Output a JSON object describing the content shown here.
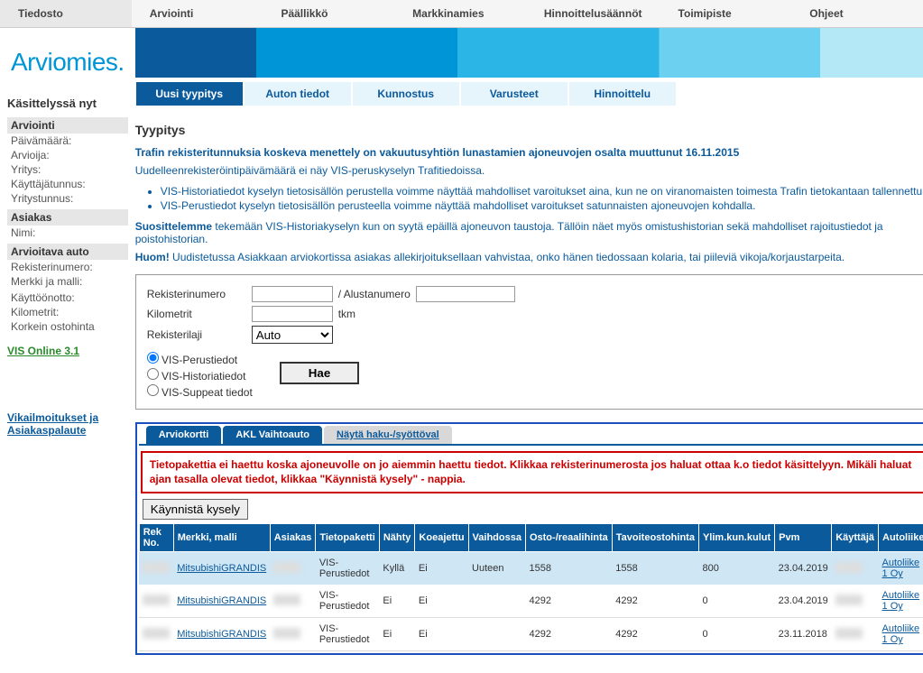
{
  "menubar": [
    "Tiedosto",
    "Arviointi",
    "Päällikkö",
    "Markkinamies",
    "Hinnoittelusäännöt",
    "Toimipiste",
    "Ohjeet"
  ],
  "logo": "Arviomies",
  "logo_suffix": ".",
  "tabs_primary": [
    {
      "label": "Uusi tyypitys",
      "active": true
    },
    {
      "label": "Auton tiedot",
      "active": false
    },
    {
      "label": "Kunnostus",
      "active": false
    },
    {
      "label": "Varusteet",
      "active": false
    },
    {
      "label": "Hinnoittelu",
      "active": false
    }
  ],
  "sidebar": {
    "title": "Käsittelyssä nyt",
    "sections": [
      {
        "head": "Arviointi",
        "lines": [
          "Päivämäärä:",
          "Arvioija:",
          "Yritys:",
          "Käyttäjätunnus:",
          "Yritystunnus:"
        ]
      },
      {
        "head": "Asiakas",
        "lines": [
          "Nimi:"
        ]
      },
      {
        "head": "Arvioitava auto",
        "lines": [
          "Rekisterinumero:",
          "Merkki ja malli:",
          "",
          "Käyttöönotto:",
          "Kilometrit:",
          "Korkein ostohinta"
        ]
      }
    ],
    "vis_link": "VIS Online 3.1",
    "feedback": "Vikailmoitukset ja Asiakaspalaute"
  },
  "main": {
    "heading": "Tyypitys",
    "notice1": "Trafin rekisteritunnuksia koskeva menettely on vakuutusyhtiön lunastamien ajoneuvojen osalta muuttunut 16.11.2015",
    "notice2": "Uudelleenrekisteröintipäivämäärä ei näy VIS-peruskyselyn Trafitiedoissa.",
    "bullets": [
      "VIS-Historiatiedot kyselyn tietosisällön perustella voimme näyttää mahdolliset varoitukset aina, kun ne on viranomaisten toimesta Trafin tietokantaan tallennettu.",
      "VIS-Perustiedot kyselyn tietosisällön perusteella voimme näyttää mahdolliset varoitukset satunnaisten ajoneuvojen kohdalla."
    ],
    "rec_prefix": "Suosittelemme",
    "rec_rest": " tekemään VIS-Historiakyselyn kun on syytä epäillä ajoneuvon taustoja. Tällöin näet myös omistushistorian sekä mahdolliset rajoitustiedot ja poistohistorian.",
    "huom_prefix": "Huom!",
    "huom_rest": " Uudistetussa Asiakkaan arviokortissa asiakas allekirjoituksellaan vahvistaa, onko hänen tiedossaan kolaria, tai piileviä vikoja/korjaustarpeita."
  },
  "form": {
    "reg_label": "Rekisterinumero",
    "reg_value": "",
    "chassis_label": "/ Alustanumero",
    "chassis_value": "",
    "km_label": "Kilometrit",
    "km_value": "",
    "km_unit": "tkm",
    "type_label": "Rekisterilaji",
    "type_value": "Auto",
    "radios": [
      "VIS-Perustiedot",
      "VIS-Historiatiedot",
      "VIS-Suppeat tiedot"
    ],
    "radio_selected": 0,
    "submit": "Hae"
  },
  "subtabs": [
    {
      "label": "Arviokortti",
      "variant": false
    },
    {
      "label": "AKL Vaihtoauto",
      "variant": false
    },
    {
      "label": "Näytä haku-/syöttöval",
      "variant": true
    }
  ],
  "alert": "Tietopakettia ei haettu koska ajoneuvolle on jo aiemmin haettu tiedot. Klikkaa rekisterinumerosta jos haluat ottaa k.o tiedot käsittelyyn. Mikäli haluat ajan tasalla olevat tiedot, klikkaa \"Käynnistä kysely\" - nappia.",
  "query_btn": "Käynnistä kysely",
  "table": {
    "headers": [
      "Rek No.",
      "Merkki, malli",
      "Asiakas",
      "Tietopaketti",
      "Nähty",
      "Koeajettu",
      "Vaihdossa",
      "Osto-/reaalihinta",
      "Tavoiteostohinta",
      "Ylim.kun.kulut",
      "Pvm",
      "Käyttäjä",
      "Autoliike"
    ],
    "rows": [
      {
        "hl": true,
        "reg": "",
        "make": "MitsubishiGRANDIS",
        "cust": "",
        "pkg": "VIS-Perustiedot",
        "seen": "Kyllä",
        "test": "Ei",
        "trade": "Uuteen",
        "buy": "1558",
        "target": "1558",
        "extra": "800",
        "date": "23.04.2019",
        "user": "",
        "dealer": "Autoliike 1 Oy"
      },
      {
        "hl": false,
        "reg": "",
        "make": "MitsubishiGRANDIS",
        "cust": "",
        "pkg": "VIS-Perustiedot",
        "seen": "Ei",
        "test": "Ei",
        "trade": "",
        "buy": "4292",
        "target": "4292",
        "extra": "0",
        "date": "23.04.2019",
        "user": "",
        "dealer": "Autoliike 1 Oy"
      },
      {
        "hl": false,
        "reg": "",
        "make": "MitsubishiGRANDIS",
        "cust": "",
        "pkg": "VIS-Perustiedot",
        "seen": "Ei",
        "test": "Ei",
        "trade": "",
        "buy": "4292",
        "target": "4292",
        "extra": "0",
        "date": "23.11.2018",
        "user": "",
        "dealer": "Autoliike 1 Oy"
      }
    ]
  }
}
